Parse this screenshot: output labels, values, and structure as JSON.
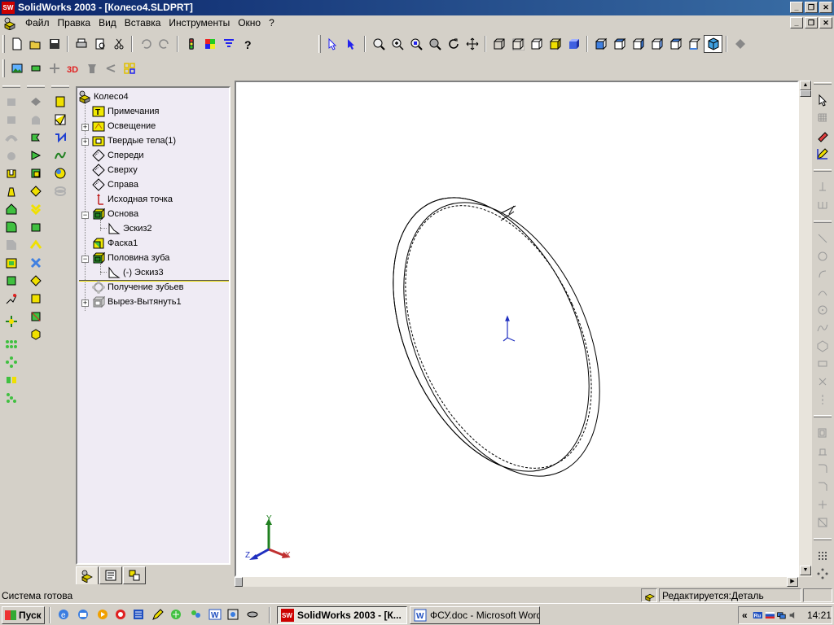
{
  "window": {
    "title": "SolidWorks 2003 - [Колесо4.SLDPRT]",
    "app_icon_text": "SW"
  },
  "menu": {
    "items": [
      "Файл",
      "Правка",
      "Вид",
      "Вставка",
      "Инструменты",
      "Окно",
      "?"
    ]
  },
  "tree": {
    "root": "Колесо4",
    "items": [
      {
        "label": "Примечания",
        "icon": "annotations-icon"
      },
      {
        "label": "Освещение",
        "icon": "lighting-icon"
      },
      {
        "label": "Твердые тела(1)",
        "icon": "solid-bodies-icon"
      },
      {
        "label": "Спереди",
        "icon": "plane-icon"
      },
      {
        "label": "Сверху",
        "icon": "plane-icon"
      },
      {
        "label": "Справа",
        "icon": "plane-icon"
      },
      {
        "label": "Исходная точка",
        "icon": "origin-icon"
      },
      {
        "label": "Основа",
        "icon": "extrude-icon"
      },
      {
        "label": "Эскиз2",
        "icon": "sketch-icon"
      },
      {
        "label": "Фаска1",
        "icon": "chamfer-icon"
      },
      {
        "label": "Половина зуба",
        "icon": "extrude-icon"
      },
      {
        "label": "(-) Эскиз3",
        "icon": "sketch-icon"
      },
      {
        "label": "Получение зубьев",
        "icon": "pattern-icon"
      },
      {
        "label": "Вырез-Вытянуть1",
        "icon": "cut-extrude-icon"
      }
    ]
  },
  "viewport": {
    "triad": {
      "x": "X",
      "y": "Y",
      "z": "Z"
    }
  },
  "status": {
    "message": "Система готова",
    "mode": "Редактируется:Деталь"
  },
  "taskbar": {
    "start": "Пуск",
    "tasks": [
      "SolidWorks 2003 - [К...",
      "ФСУ.doc - Microsoft Word"
    ],
    "lang": "«",
    "clock": "14:21"
  },
  "colors": {
    "titlebar": "#0a246a",
    "tree_bg": "#efebf4",
    "rollback_bar": "#e6d800",
    "feature_yellow": "#f0e800",
    "axis_x": "#c03030",
    "axis_y": "#208020",
    "axis_z": "#2030c0"
  }
}
